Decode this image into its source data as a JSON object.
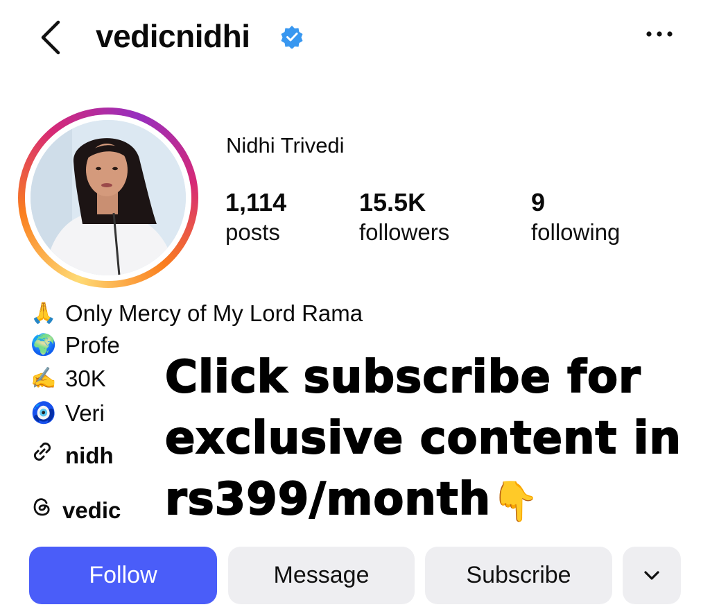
{
  "header": {
    "username": "vedicnidhi",
    "verified_color": "#3897f0"
  },
  "profile": {
    "display_name": "Nidhi Trivedi",
    "stats": [
      {
        "value": "1,114",
        "label": "posts"
      },
      {
        "value": "15.5K",
        "label": "followers"
      },
      {
        "value": "9",
        "label": "following"
      }
    ]
  },
  "bio": {
    "line1_emoji": "🙏",
    "line1": "Only Mercy of My Lord Rama",
    "line2_emoji": "🌍",
    "line2": "Profe",
    "line3_emoji": "✍️",
    "line3": "30K",
    "line4_emoji": "🧿",
    "line4": "Veri",
    "link": "nidh",
    "threads": "vedic"
  },
  "promo": {
    "line1": "Click subscribe for",
    "line2": "exclusive content in",
    "line3": "rs399/month",
    "pointer_emoji": "👇"
  },
  "buttons": {
    "follow": "Follow",
    "message": "Message",
    "subscribe": "Subscribe"
  },
  "colors": {
    "follow_bg": "#4a5df9",
    "secondary_bg": "#eeeef1"
  }
}
